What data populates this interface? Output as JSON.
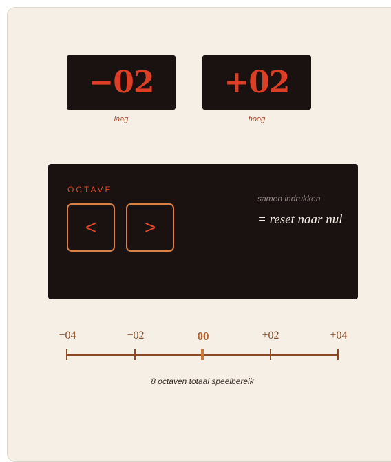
{
  "displays": {
    "low": {
      "value": "−02",
      "caption": "laag"
    },
    "high": {
      "value": "+02",
      "caption": "hoog"
    }
  },
  "octave_panel": {
    "label": "OCTAVE",
    "down_symbol": "<",
    "up_symbol": ">",
    "hint_small": "samen indrukken",
    "hint_main": "= reset naar nul"
  },
  "scale": {
    "labels": [
      "−04",
      "−02",
      "00",
      "+02",
      "+04"
    ],
    "current": "00",
    "caption": "8 octaven totaal speelbereik"
  },
  "colors": {
    "background": "#f5efe6",
    "panel": "#1a1210",
    "accent_red": "#dc3f26",
    "accent_orange": "#d98045",
    "scale_brown": "#8a4a24"
  }
}
